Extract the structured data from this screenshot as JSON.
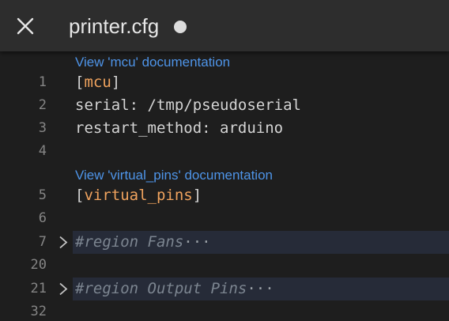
{
  "header": {
    "title": "printer.cfg",
    "close_icon": "close-icon",
    "unsaved_indicator": "unsaved-dot-icon"
  },
  "editor": {
    "codelens": [
      {
        "label": "View 'mcu' documentation"
      },
      {
        "label": "View 'virtual_pins' documentation"
      }
    ],
    "lines": [
      {
        "number": "1",
        "open": "[",
        "section": "mcu",
        "close": "]"
      },
      {
        "number": "2",
        "text": "serial: /tmp/pseudoserial"
      },
      {
        "number": "3",
        "text": "restart_method: arduino"
      },
      {
        "number": "4",
        "text": ""
      },
      {
        "number": "5",
        "open": "[",
        "section": "virtual_pins",
        "close": "]"
      },
      {
        "number": "6",
        "text": ""
      },
      {
        "number": "7",
        "comment": "#region Fans",
        "ellipsis": "···",
        "fold_icon": "chevron-right-icon"
      },
      {
        "number": "20",
        "text": ""
      },
      {
        "number": "21",
        "comment": "#region Output Pins",
        "ellipsis": "···",
        "fold_icon": "chevron-right-icon"
      },
      {
        "number": "32",
        "text": ""
      }
    ]
  },
  "colors": {
    "background": "#1e1e1e",
    "titlebar": "#2d2d2d",
    "section_name": "#f0a35e",
    "codelens_link": "#4e94e8",
    "folded_region": "#262b38",
    "line_number": "#858585"
  }
}
